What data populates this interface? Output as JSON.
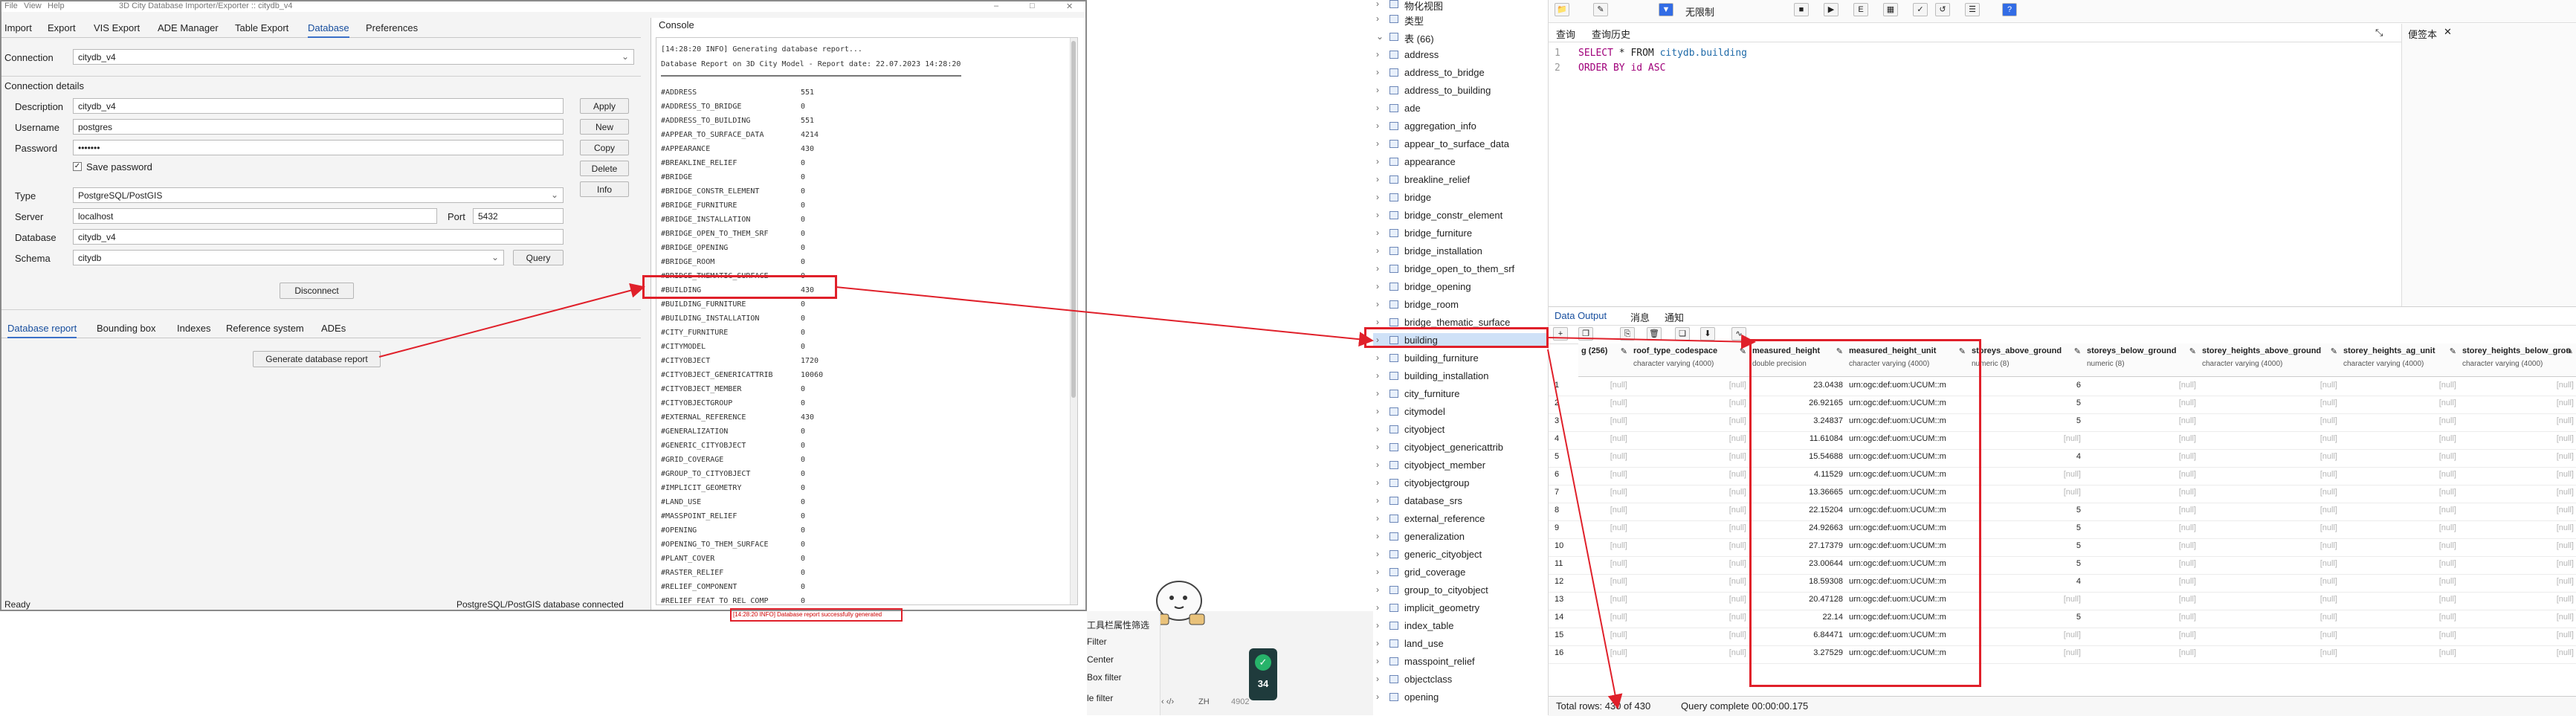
{
  "importer": {
    "title": "3D City Database Importer/Exporter :: citydb_v4",
    "menu": [
      "File",
      "View",
      "Help"
    ],
    "tabs": [
      "Import",
      "Export",
      "VIS Export",
      "ADE Manager",
      "Table Export",
      "Database",
      "Preferences"
    ],
    "connection_label": "Connection",
    "connection_value": "citydb_v4",
    "connection_details_heading": "Connection details",
    "description_label": "Description",
    "description_value": "citydb_v4",
    "username_label": "Username",
    "username_value": "postgres",
    "password_label": "Password",
    "password_value": "•••••••",
    "save_password_label": "Save password",
    "type_label": "Type",
    "type_value": "PostgreSQL/PostGIS",
    "server_label": "Server",
    "server_value": "localhost",
    "port_label": "Port",
    "port_value": "5432",
    "database_label": "Database",
    "database_value": "citydb_v4",
    "schema_label": "Schema",
    "schema_value": "citydb",
    "buttons": {
      "apply": "Apply",
      "new": "New",
      "copy": "Copy",
      "delete": "Delete",
      "info": "Info",
      "query": "Query",
      "disconnect": "Disconnect",
      "generate": "Generate database report"
    },
    "sub_tabs": [
      "Database report",
      "Bounding box",
      "Indexes",
      "Reference system",
      "ADEs"
    ],
    "console_title": "Console",
    "console_header_1": "[14:28:20 INFO] Generating database report...",
    "console_header_2": "Database Report on 3D City Model - Report date: 22.07.2023 14:28:20",
    "report_rows": [
      [
        "#ADDRESS",
        "551"
      ],
      [
        "#ADDRESS_TO_BRIDGE",
        "0"
      ],
      [
        "#ADDRESS_TO_BUILDING",
        "551"
      ],
      [
        "#APPEAR_TO_SURFACE_DATA",
        "4214"
      ],
      [
        "#APPEARANCE",
        "430"
      ],
      [
        "#BREAKLINE_RELIEF",
        "0"
      ],
      [
        "#BRIDGE",
        "0"
      ],
      [
        "#BRIDGE_CONSTR_ELEMENT",
        "0"
      ],
      [
        "#BRIDGE_FURNITURE",
        "0"
      ],
      [
        "#BRIDGE_INSTALLATION",
        "0"
      ],
      [
        "#BRIDGE_OPEN_TO_THEM_SRF",
        "0"
      ],
      [
        "#BRIDGE_OPENING",
        "0"
      ],
      [
        "#BRIDGE_ROOM",
        "0"
      ],
      [
        "#BRIDGE_THEMATIC_SURFACE",
        "0"
      ],
      [
        "#BUILDING",
        "430"
      ],
      [
        "#BUILDING_FURNITURE",
        "0"
      ],
      [
        "#BUILDING_INSTALLATION",
        "0"
      ],
      [
        "#CITY_FURNITURE",
        "0"
      ],
      [
        "#CITYMODEL",
        "0"
      ],
      [
        "#CITYOBJECT",
        "1720"
      ],
      [
        "#CITYOBJECT_GENERICATTRIB",
        "10060"
      ],
      [
        "#CITYOBJECT_MEMBER",
        "0"
      ],
      [
        "#CITYOBJECTGROUP",
        "0"
      ],
      [
        "#EXTERNAL_REFERENCE",
        "430"
      ],
      [
        "#GENERALIZATION",
        "0"
      ],
      [
        "#GENERIC_CITYOBJECT",
        "0"
      ],
      [
        "#GRID_COVERAGE",
        "0"
      ],
      [
        "#GROUP_TO_CITYOBJECT",
        "0"
      ],
      [
        "#IMPLICIT_GEOMETRY",
        "0"
      ],
      [
        "#LAND_USE",
        "0"
      ],
      [
        "#MASSPOINT_RELIEF",
        "0"
      ],
      [
        "#OPENING",
        "0"
      ],
      [
        "#OPENING_TO_THEM_SURFACE",
        "0"
      ],
      [
        "#PLANT_COVER",
        "0"
      ],
      [
        "#RASTER_RELIEF",
        "0"
      ],
      [
        "#RELIEF_COMPONENT",
        "0"
      ],
      [
        "#RELIEF_FEAT_TO_REL_COMP",
        "0"
      ]
    ],
    "status_left": "Ready",
    "status_right": "PostgreSQL/PostGIS database connected"
  },
  "middle": {
    "left_items": [
      "工具栏属性筛选",
      "Filter",
      "Center",
      "Box filter",
      "le filter"
    ],
    "footer_left": "‹ ‹/›",
    "footer_ime": "ZH",
    "footer_num": "4902",
    "badge_value": "34",
    "red_note": "[14:28:20 INFO] Database report successfully generated"
  },
  "tree": {
    "top_items": [
      "物化视图",
      "类型",
      "表 (66)"
    ],
    "tables": [
      "address",
      "address_to_bridge",
      "address_to_building",
      "ade",
      "aggregation_info",
      "appear_to_surface_data",
      "appearance",
      "breakline_relief",
      "bridge",
      "bridge_constr_element",
      "bridge_furniture",
      "bridge_installation",
      "bridge_open_to_them_srf",
      "bridge_opening",
      "bridge_room",
      "bridge_thematic_surface",
      "building",
      "building_furniture",
      "building_installation",
      "city_furniture",
      "citymodel",
      "cityobject",
      "cityobject_genericattrib",
      "cityobject_member",
      "cityobjectgroup",
      "database_srs",
      "external_reference",
      "generalization",
      "generic_cityobject",
      "grid_coverage",
      "group_to_cityobject",
      "implicit_geometry",
      "index_table",
      "land_use",
      "masspoint_relief",
      "objectclass",
      "opening"
    ],
    "selected": "building"
  },
  "query": {
    "toolbar_limit": "无限制",
    "editor_tabs": [
      "查询",
      "查询历史"
    ],
    "scratch_tab": "便签本",
    "sql_line1_kw1": "SELECT",
    "sql_line1_rest": " * FROM ",
    "sql_line1_table": "citydb.building",
    "sql_line2": "ORDER BY id ASC",
    "output_tabs": [
      "Data Output",
      "消息",
      "通知"
    ],
    "columns": [
      {
        "name": "g (256)",
        "type": ""
      },
      {
        "name": "roof_type_codespace",
        "type": "character varying (4000)"
      },
      {
        "name": "measured_height",
        "type": "double precision"
      },
      {
        "name": "measured_height_unit",
        "type": "character varying (4000)"
      },
      {
        "name": "storeys_above_ground",
        "type": "numeric (8)"
      },
      {
        "name": "storeys_below_ground",
        "type": "numeric (8)"
      },
      {
        "name": "storey_heights_above_ground",
        "type": "character varying (4000)"
      },
      {
        "name": "storey_heights_ag_unit",
        "type": "character varying (4000)"
      },
      {
        "name": "storey_heights_below_grou",
        "type": "character varying (4000)"
      }
    ],
    "rows": [
      {
        "n": "1",
        "h": "23.0438",
        "u": "urn:ogc:def:uom:UCUM::m",
        "s": "6"
      },
      {
        "n": "2",
        "h": "26.92165",
        "u": "urn:ogc:def:uom:UCUM::m",
        "s": "5"
      },
      {
        "n": "3",
        "h": "3.24837",
        "u": "urn:ogc:def:uom:UCUM::m",
        "s": "5"
      },
      {
        "n": "4",
        "h": "11.61084",
        "u": "urn:ogc:def:uom:UCUM::m",
        "s": ""
      },
      {
        "n": "5",
        "h": "15.54688",
        "u": "urn:ogc:def:uom:UCUM::m",
        "s": "4"
      },
      {
        "n": "6",
        "h": "4.11529",
        "u": "urn:ogc:def:uom:UCUM::m",
        "s": ""
      },
      {
        "n": "7",
        "h": "13.36665",
        "u": "urn:ogc:def:uom:UCUM::m",
        "s": ""
      },
      {
        "n": "8",
        "h": "22.15204",
        "u": "urn:ogc:def:uom:UCUM::m",
        "s": "5"
      },
      {
        "n": "9",
        "h": "24.92663",
        "u": "urn:ogc:def:uom:UCUM::m",
        "s": "5"
      },
      {
        "n": "10",
        "h": "27.17379",
        "u": "urn:ogc:def:uom:UCUM::m",
        "s": "5"
      },
      {
        "n": "11",
        "h": "23.00644",
        "u": "urn:ogc:def:uom:UCUM::m",
        "s": "5"
      },
      {
        "n": "12",
        "h": "18.59308",
        "u": "urn:ogc:def:uom:UCUM::m",
        "s": "4"
      },
      {
        "n": "13",
        "h": "20.47128",
        "u": "urn:ogc:def:uom:UCUM::m",
        "s": ""
      },
      {
        "n": "14",
        "h": "22.14",
        "u": "urn:ogc:def:uom:UCUM::m",
        "s": "5"
      },
      {
        "n": "15",
        "h": "6.84471",
        "u": "urn:ogc:def:uom:UCUM::m",
        "s": ""
      },
      {
        "n": "16",
        "h": "3.27529",
        "u": "urn:ogc:def:uom:UCUM::m",
        "s": ""
      }
    ],
    "null_text": "[null]",
    "total_rows": "Total rows: 430 of 430",
    "query_complete": "Query complete 00:00:00.175"
  },
  "colors": {
    "highlight": "#e0202a",
    "accent": "#3a70c8",
    "selection": "#cfe1f7",
    "pgadmin_blue": "#326ce5"
  }
}
